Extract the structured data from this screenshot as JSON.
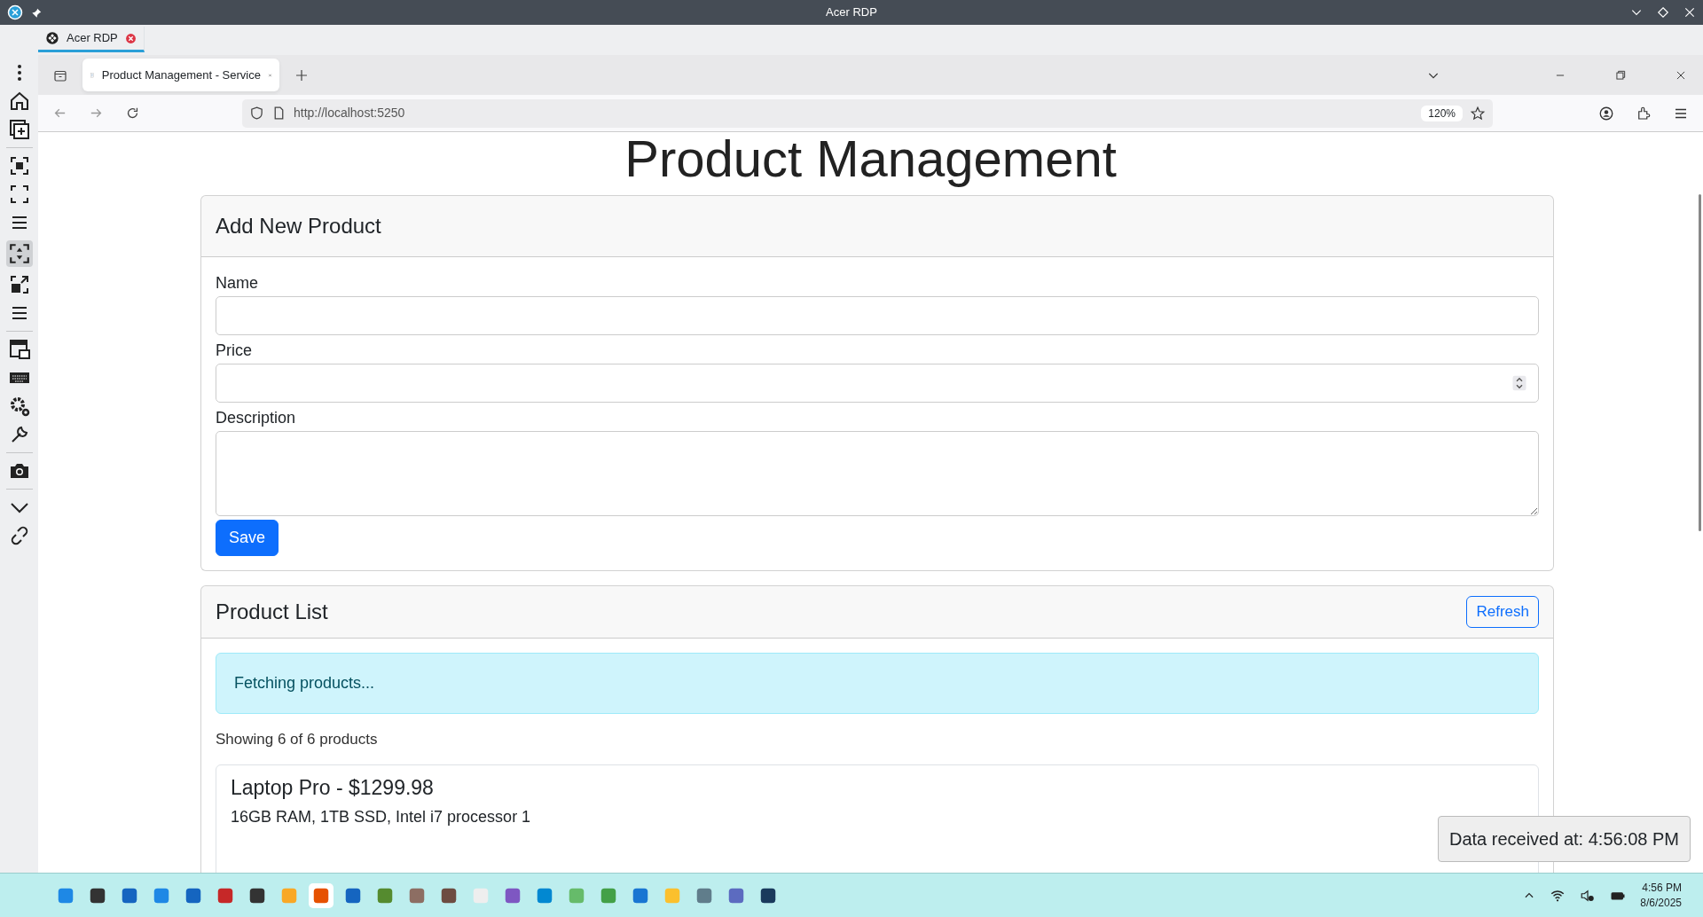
{
  "rdp_window": {
    "title": "Acer RDP",
    "tab": "Acer RDP"
  },
  "browser": {
    "tab": "Product Management - Service",
    "url": "http://localhost:5250",
    "zoom": "120%"
  },
  "page": {
    "heading": "Product Management",
    "form": {
      "title": "Add New Product",
      "fields": [
        {
          "label": "Name",
          "kind": "text"
        },
        {
          "label": "Price",
          "kind": "number"
        },
        {
          "label": "Description",
          "kind": "textarea"
        }
      ],
      "save": "Save"
    },
    "list": {
      "title": "Product List",
      "refresh": "Refresh",
      "alert": "Fetching products...",
      "count": "Showing 6 of 6 products",
      "products": [
        {
          "title": "Laptop Pro - $1299.98",
          "description": "16GB RAM, 1TB SSD, Intel i7 processor 1"
        }
      ]
    }
  },
  "toast": "Data received at: 4:56:08 PM",
  "tray": {
    "time": "4:56 PM",
    "date": "8/6/2025"
  }
}
